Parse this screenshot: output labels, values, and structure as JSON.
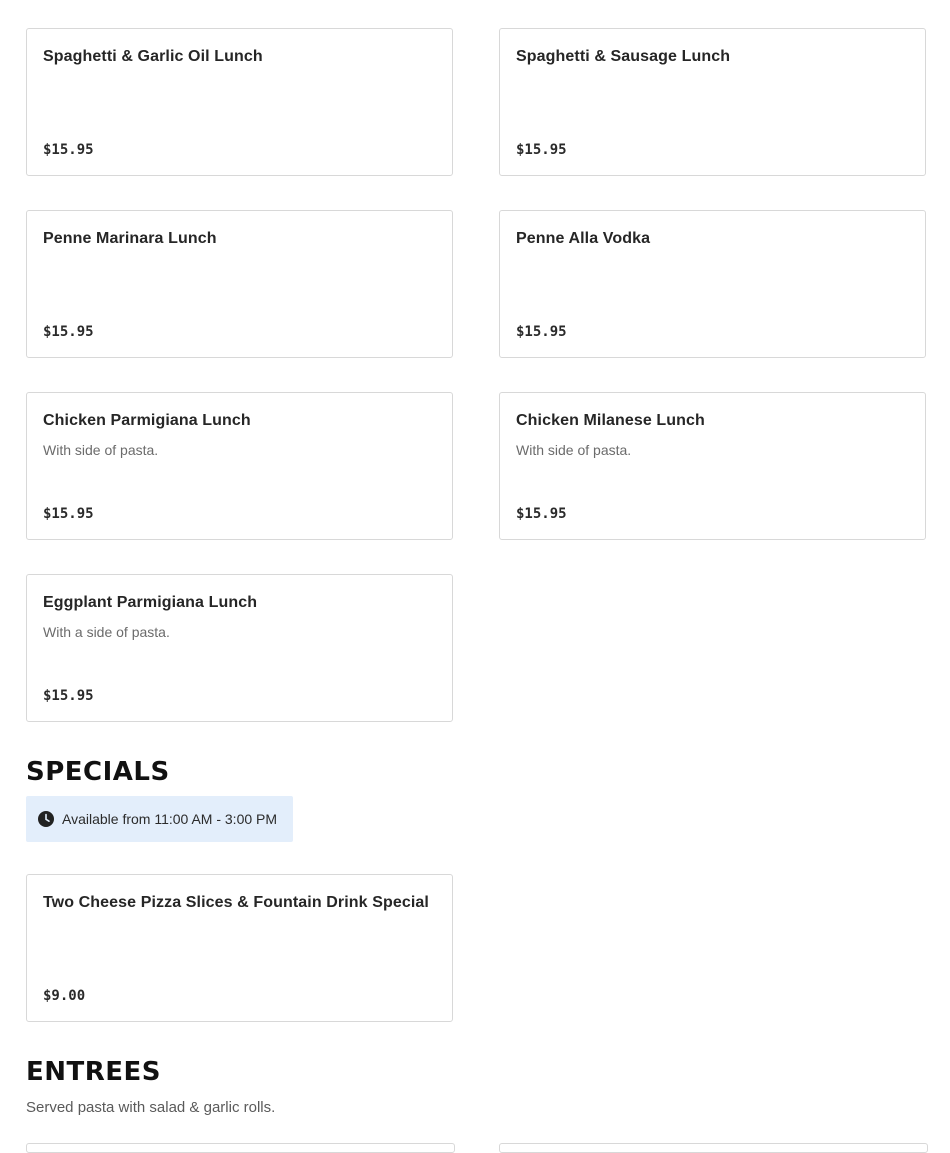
{
  "lunch_items": [
    {
      "title": "Spaghetti & Garlic Oil Lunch",
      "desc": "",
      "price": "$15.95"
    },
    {
      "title": "Spaghetti & Sausage Lunch",
      "desc": "",
      "price": "$15.95"
    },
    {
      "title": "Penne Marinara Lunch",
      "desc": "",
      "price": "$15.95"
    },
    {
      "title": "Penne Alla Vodka",
      "desc": "",
      "price": "$15.95"
    },
    {
      "title": "Chicken Parmigiana Lunch",
      "desc": "With side of pasta.",
      "price": "$15.95"
    },
    {
      "title": "Chicken Milanese Lunch",
      "desc": "With side of pasta.",
      "price": "$15.95"
    },
    {
      "title": "Eggplant Parmigiana Lunch",
      "desc": "With a side of pasta.",
      "price": "$15.95"
    }
  ],
  "specials": {
    "heading": "SPECIALS",
    "hours_icon": "clock-icon",
    "hours_text": "Available from 11:00 AM - 3:00 PM",
    "items": [
      {
        "title": "Two Cheese Pizza Slices & Fountain Drink Special",
        "desc": "",
        "price": "$9.00"
      }
    ]
  },
  "entrees": {
    "heading": "ENTREES",
    "description": "Served pasta with salad & garlic rolls."
  },
  "colors": {
    "hours_background": "#e3eefb",
    "card_border": "#d8d8d8"
  }
}
